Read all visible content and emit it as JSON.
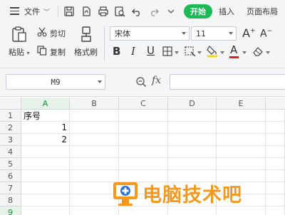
{
  "menu": {
    "file_label": "文件",
    "start_tab": "开始",
    "insert_tab": "插入",
    "page_layout_tab": "页面布局"
  },
  "ribbon": {
    "paste_label": "粘贴",
    "cut_label": "剪切",
    "copy_label": "复制",
    "format_painter_label": "格式刷",
    "font_name": "宋体",
    "font_size": "11",
    "bold": "B",
    "italic": "I",
    "underline": "U",
    "font_color_glyph": "A",
    "grow_font": "A",
    "shrink_font": "A"
  },
  "formula_bar": {
    "name_box": "M9",
    "fx_label": "fx",
    "formula": ""
  },
  "sheet": {
    "columns": [
      "A",
      "B",
      "C",
      "D",
      "E"
    ],
    "rows": [
      "1",
      "2",
      "3",
      "4",
      "5",
      "6",
      "7",
      "8",
      "9"
    ],
    "cells": {
      "A1": "序号",
      "A2": "1",
      "A3": "2"
    }
  },
  "watermark": {
    "text": "电脑技术吧"
  },
  "colors": {
    "accent_green": "#1db954",
    "watermark_orange": "#f39a1e",
    "watermark_blue": "#2b6fd6"
  }
}
